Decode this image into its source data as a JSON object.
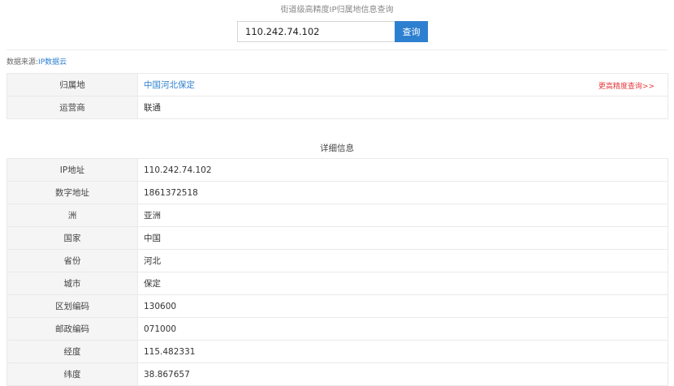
{
  "page_title": "街道级高精度IP归属地信息查询",
  "search": {
    "value": "110.242.74.102",
    "button_label": "查询"
  },
  "source": {
    "label": "数据来源:",
    "link_text": "IP数据云"
  },
  "summary": {
    "location_label": "归属地",
    "location_value": "中国河北保定",
    "more_link": "更高精度查询>>",
    "isp_label": "运营商",
    "isp_value": "联通"
  },
  "details": {
    "heading": "详细信息",
    "rows": [
      {
        "label": "IP地址",
        "value": "110.242.74.102"
      },
      {
        "label": "数字地址",
        "value": "1861372518"
      },
      {
        "label": "洲",
        "value": "亚洲"
      },
      {
        "label": "国家",
        "value": "中国"
      },
      {
        "label": "省份",
        "value": "河北"
      },
      {
        "label": "城市",
        "value": "保定"
      },
      {
        "label": "区划编码",
        "value": "130600"
      },
      {
        "label": "邮政编码",
        "value": "071000"
      },
      {
        "label": "经度",
        "value": "115.482331"
      },
      {
        "label": "纬度",
        "value": "38.867657"
      }
    ]
  },
  "colors": {
    "accent": "#2d7fd0",
    "link_red": "#e4393c",
    "label_bg": "#f5f5f5"
  }
}
